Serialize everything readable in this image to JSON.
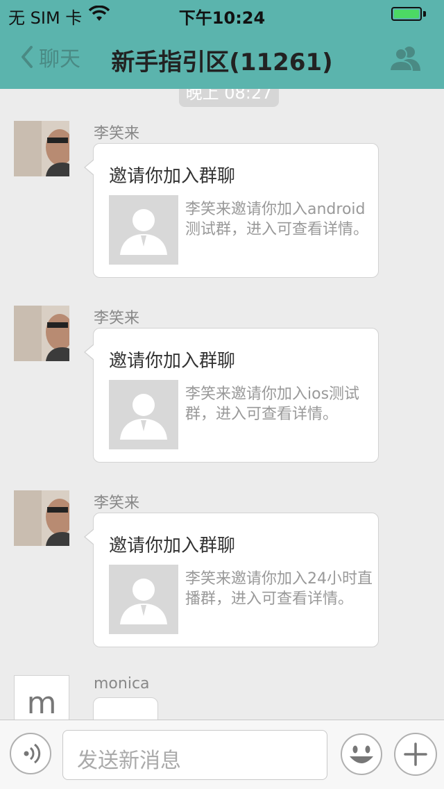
{
  "status_bar": {
    "carrier": "无 SIM 卡",
    "time": "下午10:24",
    "battery_level": 1.0
  },
  "nav": {
    "back_label": "聊天",
    "title": "新手指引区(11261)",
    "group_icon": "group-members-icon"
  },
  "timestamp_pill": "晚上 08:27",
  "messages": [
    {
      "sender": "李笑来",
      "card_title": "邀请你加入群聊",
      "card_desc": "李笑来邀请你加入android测试群，进入可查看详情。"
    },
    {
      "sender": "李笑来",
      "card_title": "邀请你加入群聊",
      "card_desc": "李笑来邀请你加入ios测试群，进入可查看详情。"
    },
    {
      "sender": "李笑来",
      "card_title": "邀请你加入群聊",
      "card_desc": "李笑来邀请你加入24小时直播群，进入可查看详情。"
    },
    {
      "sender": "monica",
      "avatar_letter": "m"
    }
  ],
  "input_bar": {
    "placeholder": "发送新消息",
    "icons": [
      "voice-icon",
      "emoji-icon",
      "plus-icon"
    ]
  },
  "colors": {
    "nav_background": "#5bb4ad",
    "page_background": "#ececec",
    "battery_fill": "#4cd964"
  }
}
